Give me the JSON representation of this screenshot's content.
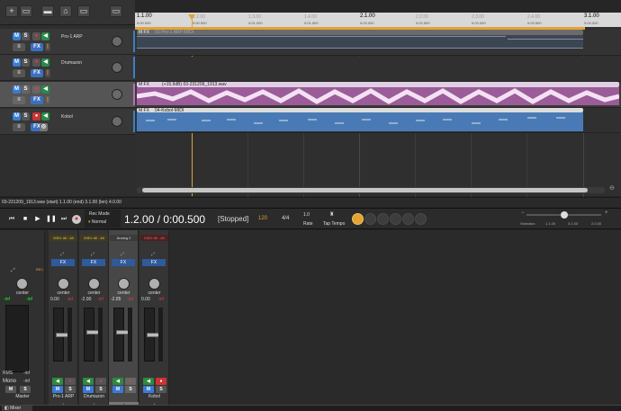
{
  "toolbar": {
    "buttons": [
      "+",
      "▭",
      "▬",
      "⌂",
      "▭",
      "▭"
    ]
  },
  "tracks": [
    {
      "name": "Pro-1 ARP",
      "color": "#3b7fc4"
    },
    {
      "name": "Drumazon",
      "color": "#3b7fc4"
    },
    {
      "name": "",
      "color": "#b76fb6"
    },
    {
      "name": "Kobol",
      "color": "#3b7fc4"
    }
  ],
  "track_buttons": {
    "mute": "M",
    "solo": "S",
    "fx": "FX"
  },
  "ruler": {
    "bars": [
      "1.1.00",
      "1.2.00",
      "1.3.00",
      "1.4.00",
      "2.1.00",
      "2.2.00",
      "2.3.00",
      "2.4.00",
      "3.1.00"
    ],
    "times": [
      "0:00.000",
      "0:00.500",
      "0:01.000",
      "0:01.500",
      "0:02.000",
      "0:02.500",
      "0:03.000",
      "0:03.500",
      "0:04.000"
    ]
  },
  "clips": {
    "midi1": "01-Pro-1 ARP-MIDI",
    "audio": "(+15.9dB) 03-231209_1913.wav",
    "midi4": "04-Kobol-MIDI",
    "prefix": "M FX"
  },
  "status_line": "03-231209_1913.wav (start) 1.1.00 (end) 3.1.00 (len) 4.0.00",
  "transport": {
    "rec_mode_label": "Rec Mode",
    "rec_mode_value": "Normal",
    "position": "1.2.00 / 0:00.500",
    "state": "[Stopped]",
    "bpm": "120",
    "time_sig": "4/4",
    "rate_value": "1.0",
    "rate_label": "Rate",
    "tap_label": "Tap Tempo",
    "selection_label": "Selection",
    "sel_start": "1.1.00",
    "sel_end": "3.1.00",
    "sel_len": "2.0.00"
  },
  "mixer": {
    "master": {
      "label": "Master",
      "pan": "center",
      "value": "-inf",
      "rms": "RMS",
      "rms_val": "-inf",
      "mono": "Mono",
      "mono_val": "-inf"
    },
    "strips": [
      {
        "label": "Pro-1 ARP",
        "num": "1",
        "input": "MIDI: All : All",
        "gain": "0.00",
        "peak": "-inf",
        "fader": 0.55,
        "selected": false
      },
      {
        "label": "Drumazon",
        "num": "2",
        "input": "MIDI: All : All",
        "gain": "-2.90",
        "peak": "-inf",
        "fader": 0.6,
        "selected": false
      },
      {
        "label": "3",
        "num": "3",
        "input": "Analog 2",
        "gain": "-2.85",
        "peak": "-inf",
        "fader": 0.6,
        "selected": true
      },
      {
        "label": "Kobol",
        "num": "4",
        "input": "MIDI: All : All",
        "gain": "0.00",
        "peak": "-inf",
        "fader": 0.55,
        "selected": false
      }
    ],
    "pan": "center",
    "rec_label": "Rec",
    "fx_label": "FX",
    "bottom_tab": "Mixer"
  }
}
